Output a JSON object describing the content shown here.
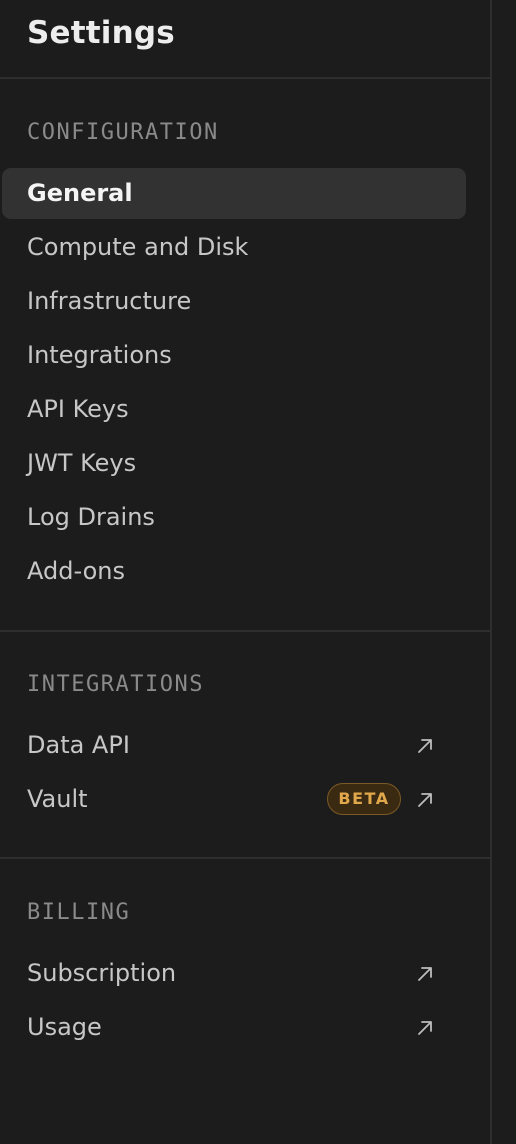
{
  "page": {
    "title": "Settings"
  },
  "sections": {
    "configuration": {
      "heading": "CONFIGURATION",
      "items": [
        "General",
        "Compute and Disk",
        "Infrastructure",
        "Integrations",
        "API Keys",
        "JWT Keys",
        "Log Drains",
        "Add-ons"
      ],
      "active": "General"
    },
    "integrations": {
      "heading": "INTEGRATIONS",
      "items": [
        "Data API",
        "Vault"
      ],
      "badge": "BETA",
      "badge_item": "Vault",
      "item_icon": "external-link-icon"
    },
    "billing": {
      "heading": "BILLING",
      "items": [
        "Subscription",
        "Usage"
      ],
      "item_icon": "external-link-icon"
    }
  },
  "colors": {
    "background": "#1c1c1c",
    "active_item": "#323232",
    "badge_text": "#e0a84a",
    "badge_border": "#7a5a25"
  }
}
